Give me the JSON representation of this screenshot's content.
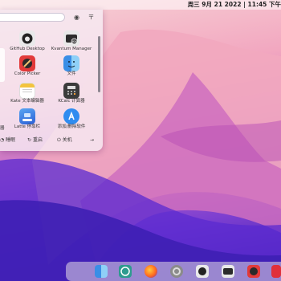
{
  "topbar": {
    "clock": "周三 9月 21 2022 | 11:45 下午"
  },
  "launcher": {
    "search": {
      "value": "",
      "placeholder": ""
    },
    "top_icons": [
      "eye-icon",
      "pin-icon"
    ],
    "apps": [
      {
        "label": "GitHub Desktop",
        "icon": "github-icon"
      },
      {
        "label": "Kvantum Manager",
        "icon": "kvantum-icon"
      },
      {
        "label": "Color Picker",
        "icon": "color-picker-icon"
      },
      {
        "label": "文件",
        "icon": "finder-icon"
      },
      {
        "label": "Kate 文本编辑器",
        "icon": "notes-icon"
      },
      {
        "label": "KCalc 计算器",
        "icon": "calculator-icon"
      },
      {
        "label": "Latte 停靠栏",
        "icon": "latte-dock-icon"
      },
      {
        "label": "添加/删除软件",
        "icon": "app-store-icon"
      }
    ],
    "partial_left_label": "器",
    "power": {
      "sleep": "睡眠",
      "restart": "重启",
      "shutdown": "关机",
      "arrow": "→"
    }
  },
  "dock": {
    "icons": [
      "finder-icon",
      "browser-icon",
      "firefox-icon",
      "settings-icon",
      "github-icon",
      "kvantum-icon",
      "color-picker-icon",
      "app-red-icon"
    ]
  },
  "colors": {
    "accent": "#4a90e2",
    "wallpaper_top": "#f7d3d6",
    "wallpaper_bottom": "#3b1ea8"
  }
}
